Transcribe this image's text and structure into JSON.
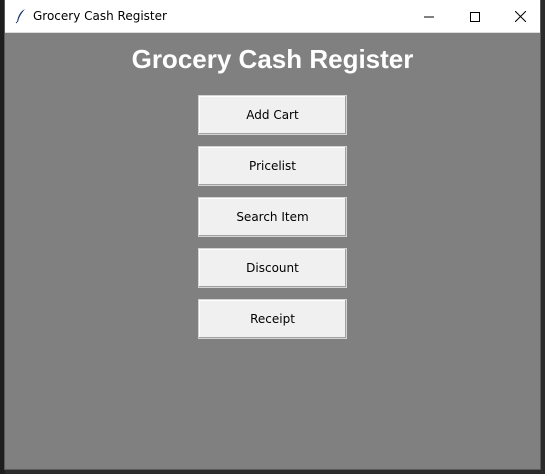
{
  "window": {
    "title": "Grocery Cash Register"
  },
  "heading": "Grocery Cash Register",
  "buttons": {
    "add_cart": "Add Cart",
    "pricelist": "Pricelist",
    "search_item": "Search Item",
    "discount": "Discount",
    "receipt": "Receipt"
  },
  "icons": {
    "app": "feather-icon",
    "minimize": "minimize-icon",
    "maximize": "maximize-icon",
    "close": "close-icon"
  },
  "colors": {
    "window_bg": "#808080",
    "button_bg": "#f0f0f0",
    "heading": "#ffffff"
  }
}
